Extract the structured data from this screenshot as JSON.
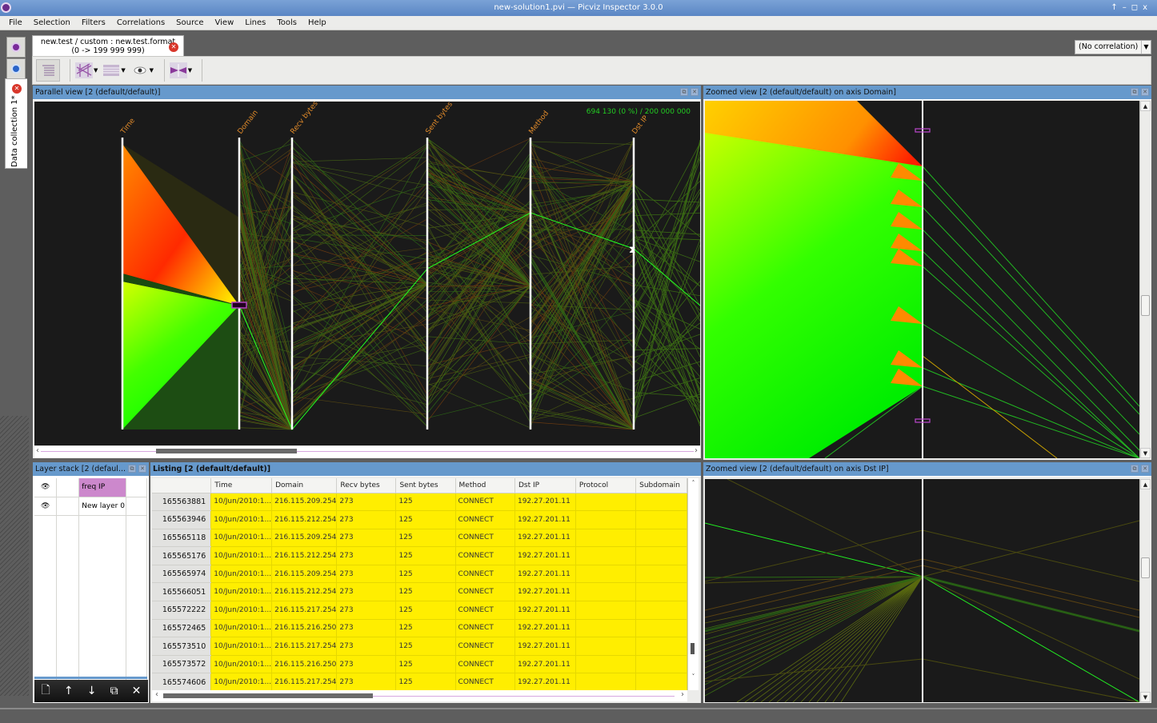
{
  "window": {
    "title": "new-solution1.pvi — Picviz Inspector 3.0.0",
    "controls": [
      "↑",
      "–",
      "◻",
      "x"
    ]
  },
  "menu": [
    "File",
    "Selection",
    "Filters",
    "Correlations",
    "Source",
    "View",
    "Lines",
    "Tools",
    "Help"
  ],
  "left_dock": {
    "data_collection_tab": "Data collection 1*"
  },
  "doc_tab": {
    "line1": "new.test / custom : new.test.format",
    "line2": "(0 -> 199 999 999)"
  },
  "correlation_select": {
    "value": "(No correlation)"
  },
  "toolbar": {
    "items": [
      "listing-toggle",
      "axes-mode",
      "layers-mode",
      "visibility",
      "zoom-mode"
    ]
  },
  "parallel_view": {
    "title": "Parallel view [2 (default/default)]",
    "counter": "694 130 (0 %) / 200 000 000",
    "axes": [
      "Time",
      "Domain",
      "Recv bytes",
      "Sent bytes",
      "Method",
      "Dst IP"
    ],
    "axis_color": "#e08a2a",
    "counter_color": "#22cc22"
  },
  "zoomed_domain": {
    "title": "Zoomed view [2 (default/default) on axis Domain]"
  },
  "zoomed_dstip": {
    "title": "Zoomed view [2 (default/default) on axis Dst IP]"
  },
  "layer_stack": {
    "title": "Layer stack [2 (defaul...",
    "layers": [
      {
        "name": "freq IP",
        "visible": true,
        "selected": true
      },
      {
        "name": "New layer 0",
        "visible": true,
        "selected": false
      }
    ],
    "buttons": [
      "new-layer",
      "move-up",
      "move-down",
      "duplicate",
      "delete"
    ]
  },
  "listing": {
    "title": "Listing [2 (default/default)]",
    "columns": [
      "Time",
      "Domain",
      "Recv bytes",
      "Sent bytes",
      "Method",
      "Dst IP",
      "Protocol",
      "Subdomain"
    ],
    "rows": [
      {
        "id": "165563881",
        "cells": [
          "10/Jun/2010:1...",
          "216.115.209.254",
          "273",
          "125",
          "CONNECT",
          "192.27.201.11",
          "",
          ""
        ]
      },
      {
        "id": "165563946",
        "cells": [
          "10/Jun/2010:1...",
          "216.115.212.254",
          "273",
          "125",
          "CONNECT",
          "192.27.201.11",
          "",
          ""
        ]
      },
      {
        "id": "165565118",
        "cells": [
          "10/Jun/2010:1...",
          "216.115.209.254",
          "273",
          "125",
          "CONNECT",
          "192.27.201.11",
          "",
          ""
        ]
      },
      {
        "id": "165565176",
        "cells": [
          "10/Jun/2010:1...",
          "216.115.212.254",
          "273",
          "125",
          "CONNECT",
          "192.27.201.11",
          "",
          ""
        ]
      },
      {
        "id": "165565974",
        "cells": [
          "10/Jun/2010:1...",
          "216.115.209.254",
          "273",
          "125",
          "CONNECT",
          "192.27.201.11",
          "",
          ""
        ]
      },
      {
        "id": "165566051",
        "cells": [
          "10/Jun/2010:1...",
          "216.115.212.254",
          "273",
          "125",
          "CONNECT",
          "192.27.201.11",
          "",
          ""
        ]
      },
      {
        "id": "165572222",
        "cells": [
          "10/Jun/2010:1...",
          "216.115.217.254",
          "273",
          "125",
          "CONNECT",
          "192.27.201.11",
          "",
          ""
        ]
      },
      {
        "id": "165572465",
        "cells": [
          "10/Jun/2010:1...",
          "216.115.216.250",
          "273",
          "125",
          "CONNECT",
          "192.27.201.11",
          "",
          ""
        ]
      },
      {
        "id": "165573510",
        "cells": [
          "10/Jun/2010:1...",
          "216.115.217.254",
          "273",
          "125",
          "CONNECT",
          "192.27.201.11",
          "",
          ""
        ]
      },
      {
        "id": "165573572",
        "cells": [
          "10/Jun/2010:1...",
          "216.115.216.250",
          "273",
          "125",
          "CONNECT",
          "192.27.201.11",
          "",
          ""
        ]
      },
      {
        "id": "165574606",
        "cells": [
          "10/Jun/2010:1...",
          "216.115.217.254",
          "273",
          "125",
          "CONNECT",
          "192.27.201.11",
          "",
          ""
        ]
      }
    ],
    "row_color": "#ffee00"
  }
}
